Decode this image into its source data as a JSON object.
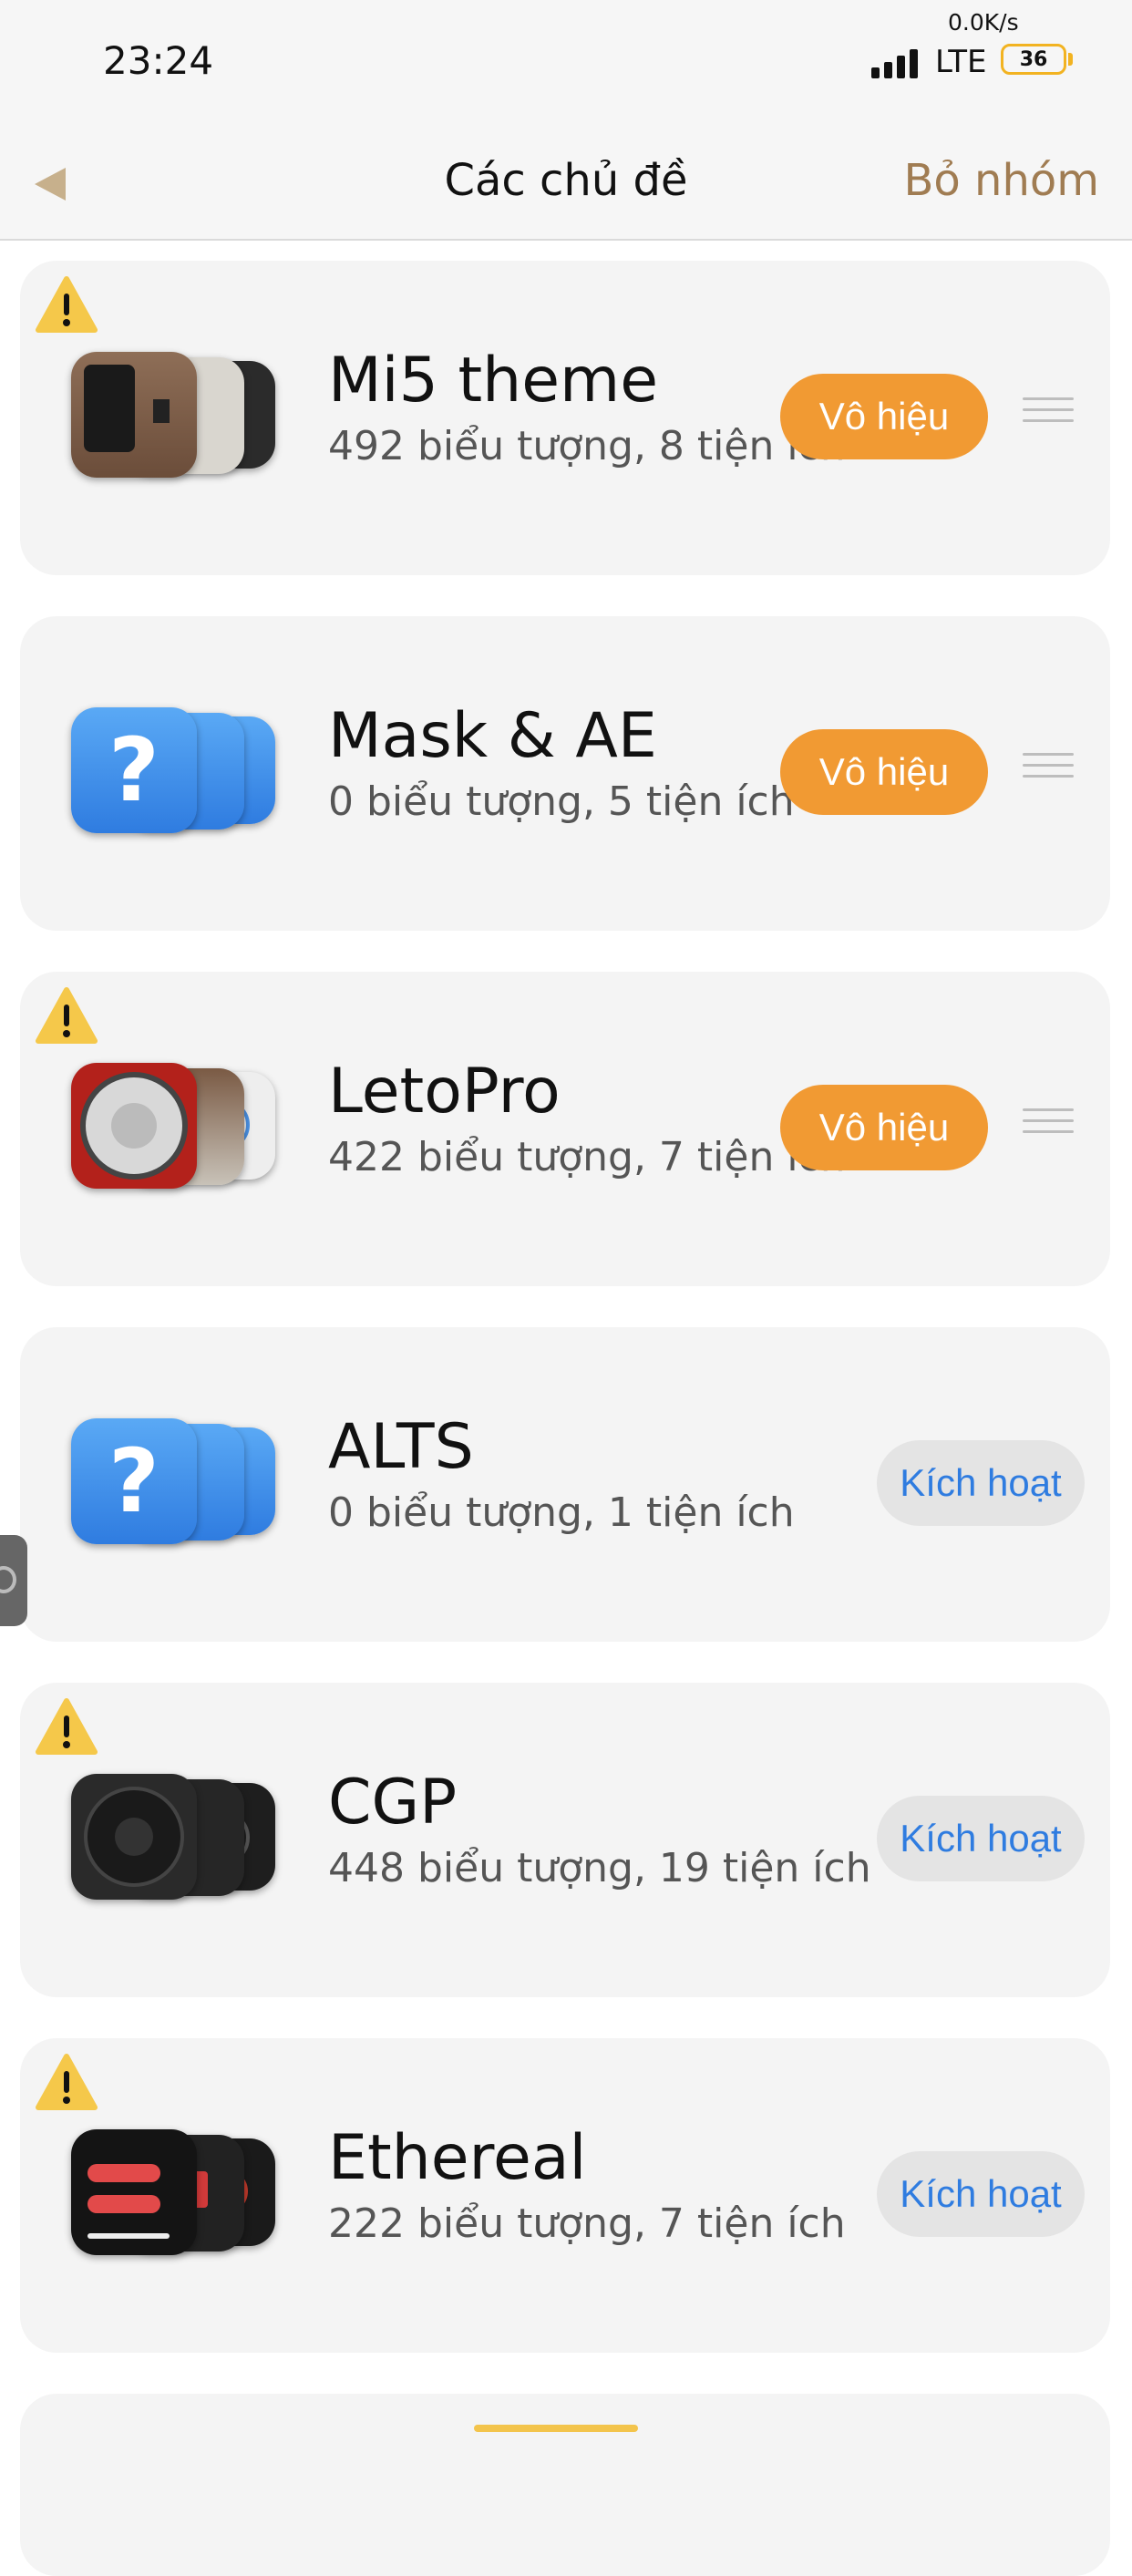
{
  "status_bar": {
    "time": "23:24",
    "net_speed": "0.0K/s",
    "network": "LTE",
    "battery": "36"
  },
  "nav": {
    "title": "Các chủ đề",
    "right_action": "Bỏ nhóm"
  },
  "themes": [
    {
      "name": "Mi5 theme",
      "subtitle": "492 biểu tượng, 8 tiện ích",
      "button": "Vô hiệu",
      "warning": true
    },
    {
      "name": "Mask & AE",
      "subtitle": "0 biểu tượng, 5 tiện ích",
      "button": "Vô hiệu",
      "warning": false
    },
    {
      "name": "LetoPro",
      "subtitle": "422 biểu tượng, 7 tiện ích",
      "button": "Vô hiệu",
      "warning": true
    },
    {
      "name": "ALTS",
      "subtitle": "0 biểu tượng, 1 tiện ích",
      "button": "Kích hoạt",
      "warning": false
    },
    {
      "name": "CGP",
      "subtitle": "448 biểu tượng, 19 tiện ích",
      "button": "Kích hoạt",
      "warning": true
    },
    {
      "name": "Ethereal",
      "subtitle": "222 biểu tượng, 7 tiện ích",
      "button": "Kích hoạt",
      "warning": true
    }
  ],
  "colors": {
    "disable_button": "#f19a33",
    "activate_text": "#2f7ce0",
    "nav_action": "#a07c52",
    "warning": "#f5c84a"
  }
}
